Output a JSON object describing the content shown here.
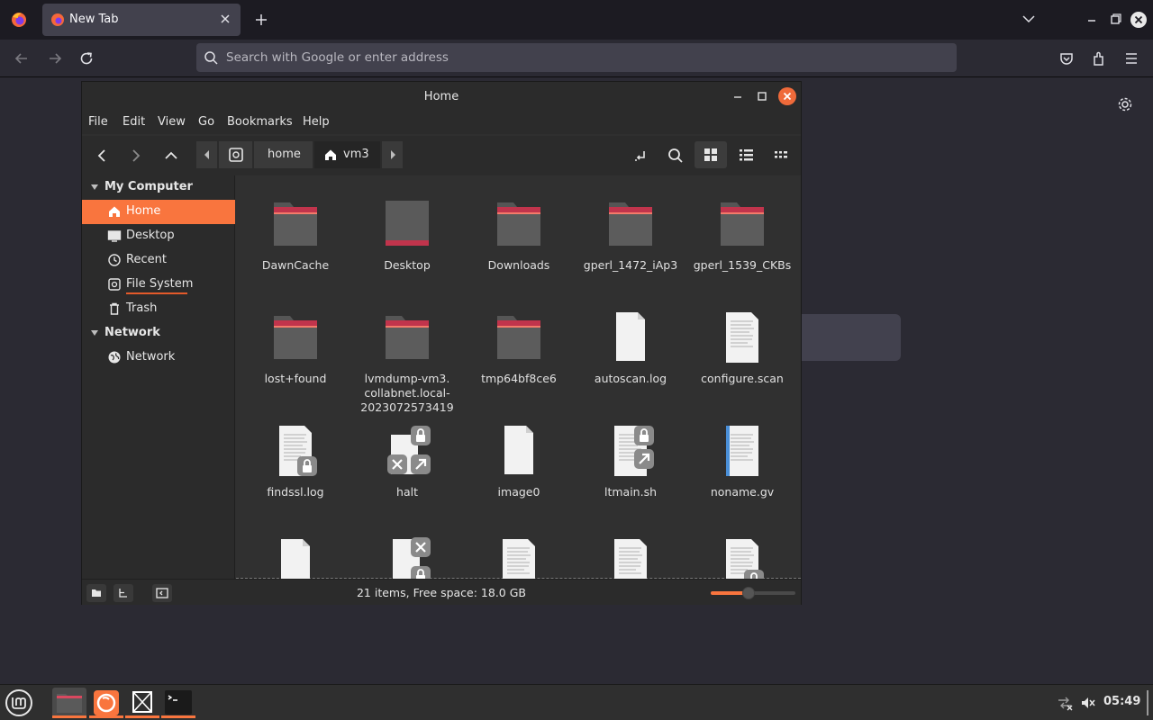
{
  "browser": {
    "tab_title": "New Tab",
    "url_placeholder": "Search with Google or enter address"
  },
  "nemo": {
    "window_title": "Home",
    "menu": [
      "File",
      "Edit",
      "View",
      "Go",
      "Bookmarks",
      "Help"
    ],
    "path": [
      "home",
      "vm3"
    ],
    "sidebar": {
      "sections": [
        {
          "label": "My Computer",
          "items": [
            {
              "label": "Home",
              "icon": "home-icon",
              "selected": true
            },
            {
              "label": "Desktop",
              "icon": "desktop-icon"
            },
            {
              "label": "Recent",
              "icon": "recent-icon"
            },
            {
              "label": "File System",
              "icon": "drive-icon"
            },
            {
              "label": "Trash",
              "icon": "trash-icon"
            }
          ]
        },
        {
          "label": "Network",
          "items": [
            {
              "label": "Network",
              "icon": "network-icon"
            }
          ]
        }
      ]
    },
    "files": [
      {
        "name": "DawnCache",
        "type": "folder"
      },
      {
        "name": "Desktop",
        "type": "folder-desktop"
      },
      {
        "name": "Downloads",
        "type": "folder"
      },
      {
        "name": "gperl_1472_iAp3",
        "type": "folder"
      },
      {
        "name": "gperl_1539_CKBs",
        "type": "folder"
      },
      {
        "name": "lost+found",
        "type": "folder"
      },
      {
        "name": "lvmdump-vm3.\ncollabnet.local-\n2023072573419",
        "type": "folder"
      },
      {
        "name": "tmp64bf8ce6",
        "type": "folder"
      },
      {
        "name": "autoscan.log",
        "type": "blank"
      },
      {
        "name": "configure.scan",
        "type": "text"
      },
      {
        "name": "findssl.log",
        "type": "text-lock"
      },
      {
        "name": "halt",
        "type": "link-broken-lock"
      },
      {
        "name": "image0",
        "type": "blank"
      },
      {
        "name": "ltmain.sh",
        "type": "script-lock-link"
      },
      {
        "name": "noname.gv",
        "type": "doc-blue"
      },
      {
        "name": "",
        "type": "blank"
      },
      {
        "name": "",
        "type": "blank-broken-lock"
      },
      {
        "name": "",
        "type": "text"
      },
      {
        "name": "",
        "type": "text"
      },
      {
        "name": "",
        "type": "text-lock"
      }
    ],
    "status": "21 items, Free space: 18.0 GB",
    "zoom_level": 0.45
  },
  "taskbar": {
    "clock": "05:49",
    "apps": [
      "files",
      "firefox",
      "window-manager",
      "terminal"
    ]
  },
  "colors": {
    "accent": "#f9753e",
    "folder_body": "#5a5a5a",
    "folder_tab": "#c1344c"
  }
}
